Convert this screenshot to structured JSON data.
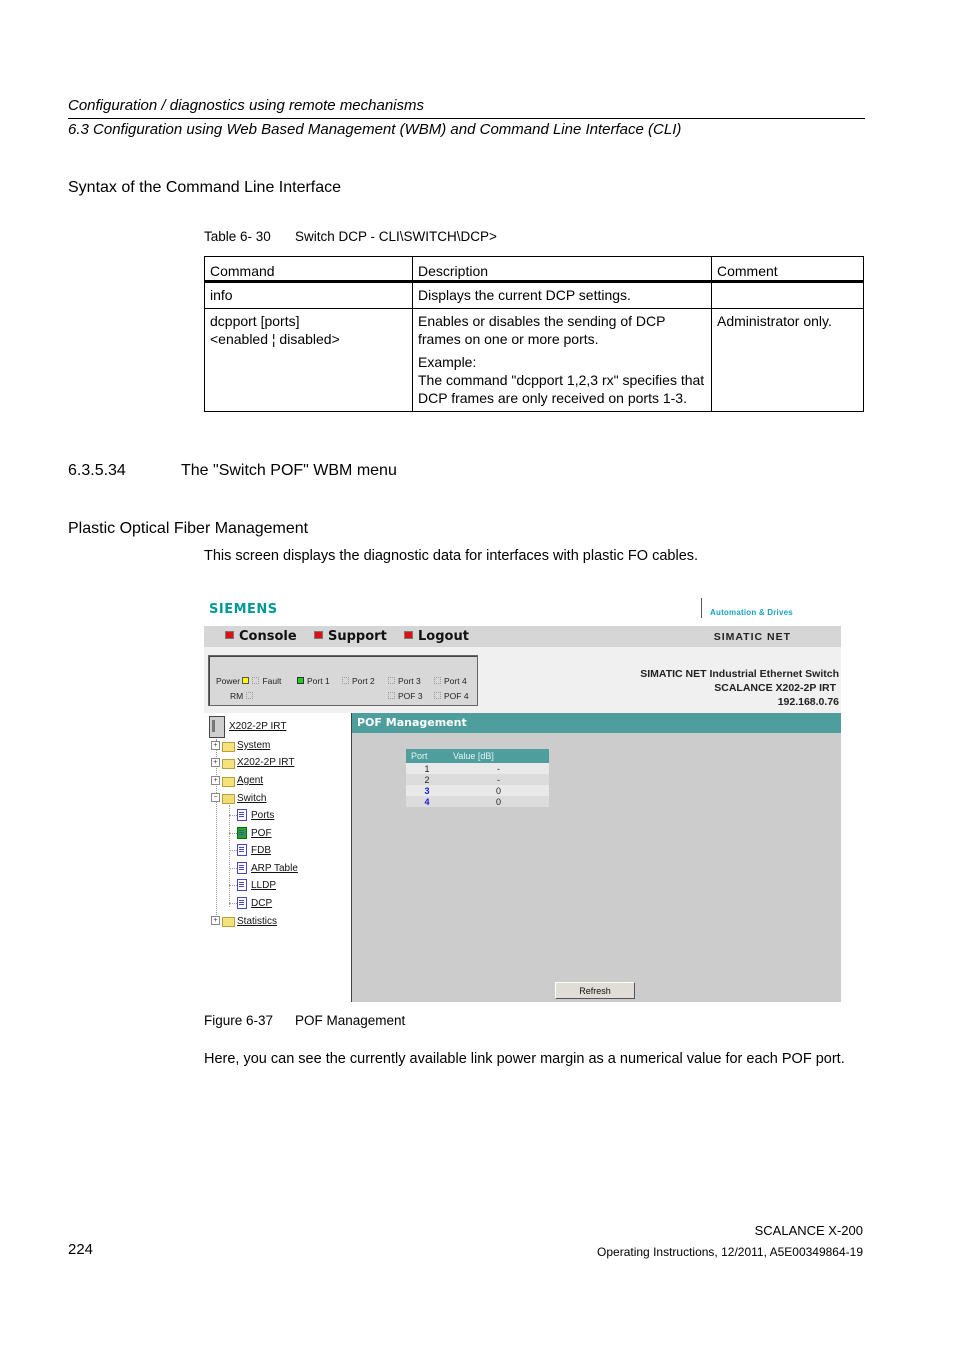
{
  "header": {
    "chapter": "Configuration / diagnostics using remote mechanisms",
    "section": "6.3 Configuration using Web Based Management (WBM) and Command Line Interface (CLI)"
  },
  "syntax_heading": "Syntax of the Command Line Interface",
  "table_caption": {
    "number": "Table 6- 30",
    "title": "Switch DCP - CLI\\SWITCH\\DCP>"
  },
  "cli_table": {
    "columns": [
      "Command",
      "Description",
      "Comment"
    ],
    "rows": [
      {
        "command": [
          "info"
        ],
        "description": [
          "Displays the current DCP settings."
        ],
        "comment": ""
      },
      {
        "command": [
          "dcpport [ports]",
          "<enabled ¦ disabled>"
        ],
        "description": [
          "Enables or disables the sending of DCP frames on one or more ports.",
          "Example:",
          "The command \"dcpport 1,2,3 rx\" specifies that DCP frames are only received on ports 1-3."
        ],
        "comment": "Administrator only."
      }
    ]
  },
  "section_heading": {
    "number": "6.3.5.34",
    "title": "The \"Switch POF\" WBM menu"
  },
  "subheading": "Plastic Optical Fiber Management",
  "intro_text": "This screen displays the diagnostic data for interfaces with plastic FO cables.",
  "wbm": {
    "logo": "SIEMENS",
    "tagline": "Automation & Drives",
    "menu": [
      "Console",
      "Support",
      "Logout"
    ],
    "product_line": "SIMATIC NET",
    "leds": {
      "power": "Power",
      "fault": "Fault",
      "rm": "RM",
      "ports": [
        "Port 1",
        "Port 2",
        "Port 3",
        "Port 4"
      ],
      "pof": [
        "POF 3",
        "POF 4"
      ],
      "power_state": "on",
      "port1_state": "on"
    },
    "device": {
      "line1": "SIMATIC NET Industrial Ethernet Switch",
      "line2": "SCALANCE X202-2P IRT",
      "ip": "192.168.0.76"
    },
    "tree": {
      "root": "X202-2P IRT",
      "folders": [
        "System",
        "X202-2P IRT",
        "Agent",
        "Switch"
      ],
      "switch_children": [
        "Ports",
        "POF",
        "FDB",
        "ARP Table",
        "LLDP",
        "DCP"
      ],
      "last_folder": "Statistics",
      "active": "POF"
    },
    "content_title": "POF Management",
    "pof_table": {
      "columns": [
        "Port",
        "Value [dB]"
      ],
      "rows": [
        {
          "port": "1",
          "value": "-",
          "link": false
        },
        {
          "port": "2",
          "value": "-",
          "link": false
        },
        {
          "port": "3",
          "value": "0",
          "link": true
        },
        {
          "port": "4",
          "value": "0",
          "link": true
        }
      ]
    },
    "refresh_label": "Refresh",
    "colors": {
      "accent_teal": "#4f9e9e",
      "logo_teal": "#009999",
      "menu_bullet": "#dd1111",
      "led_yellow": "#ffff00",
      "led_green": "#22cc22"
    }
  },
  "figure_caption": {
    "number": "Figure 6-37",
    "title": "POF Management"
  },
  "outro_text": "Here, you can see the currently available link power margin as a numerical value for each POF port.",
  "footer": {
    "page": "224",
    "product": "SCALANCE X-200",
    "doc": "Operating Instructions, 12/2011, A5E00349864-19"
  }
}
